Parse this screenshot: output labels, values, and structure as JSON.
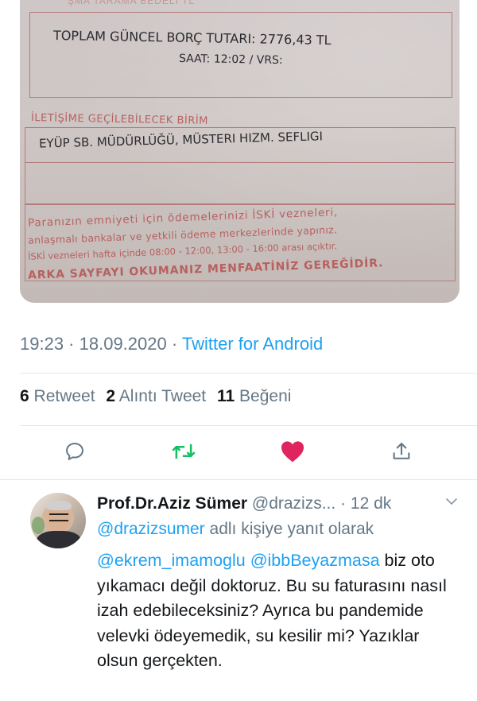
{
  "photo": {
    "top_cut": "ŞMA TARAMA BEDELİ TL",
    "total_debt": "TOPLAM GÜNCEL BORÇ TUTARI: 2776,43 TL",
    "time_line": "SAAT: 12:02 / VRS:",
    "contact_label": "İLETİŞİME GEÇİLEBİLECEK BİRİM",
    "unit": "EYÜP SB. MÜDÜRLÜĞÜ, MÜSTERI HIZM. SEFLIGI",
    "notice_1": "Paranızın emniyeti için ödemelerinizi İSKİ vezneleri,",
    "notice_2": "anlaşmalı bankalar ve yetkili ödeme merkezlerinde yapınız.",
    "notice_3": "İSKİ vezneleri hafta içinde 08:00 - 12:00, 13:00 - 16:00 arası açıktır.",
    "notice_4": "ARKA SAYFAYI OKUMANIZ MENFAATİNİZ GEREĞİDİR."
  },
  "tweet_meta": {
    "time": "19:23",
    "dot1": " · ",
    "date": "18.09.2020",
    "dot2": " · ",
    "app": "Twitter for Android"
  },
  "stats": {
    "retweets_count": "6",
    "retweets_label": "Retweet",
    "quotes_count": "2",
    "quotes_label": "Alıntı Tweet",
    "likes_count": "11",
    "likes_label": "Beğeni"
  },
  "actions": {
    "icons": [
      "reply-icon",
      "retweet-icon",
      "like-icon",
      "share-icon"
    ],
    "retweet_color": "#17bf63",
    "like_color": "#e0245e",
    "neutral_color": "#657786"
  },
  "reply": {
    "name": "Prof.Dr.Aziz Sümer",
    "handle": "@drazizs...",
    "time": "· 12 dk",
    "replying_to": "@drazizsumer",
    "replying_suffix": " adlı kişiye yanıt olarak",
    "mention1": "@ekrem_imamoglu",
    "mention2": "@ibbBeyazmasa",
    "text": " biz oto yıkamacı değil doktoruz. Bu su faturasını nasıl izah edebileceksiniz? Ayrıca bu pandemide velevki ödeyemedik, su kesilir mi? Yazıklar olsun gerçekten.",
    "link_color": "#1da1f2"
  }
}
